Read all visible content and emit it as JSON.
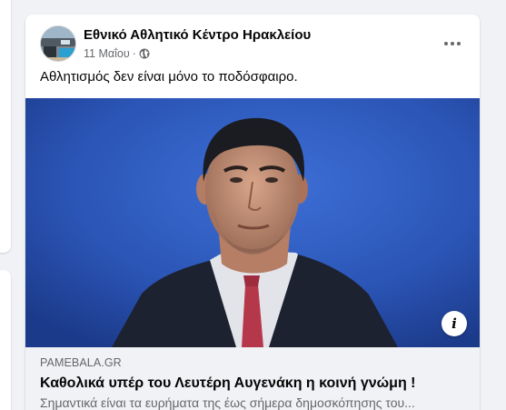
{
  "post": {
    "author": "Εθνικό Αθλητικό Κέντρο Ηρακλείου",
    "date": "11 Μαΐου",
    "separator": "·",
    "privacy_icon": "globe-icon",
    "more_icon": "more-horizontal-icon",
    "text": "Αθλητισμός δεν είναι μόνο το ποδόσφαιρο.",
    "image": {
      "description_icon": "info-icon",
      "info_label": "i"
    },
    "link_preview": {
      "domain": "PAMEBALA.GR",
      "title": "Καθολικά υπέρ του Λευτέρη Αυγενάκη η κοινή γνώμη !",
      "description": "Σημαντικά είναι τα ευρήματα της έως σήμερα δημοσκόπησης του..."
    }
  },
  "colors": {
    "page_bg": "#f0f2f5",
    "card_bg": "#ffffff",
    "primary_text": "#050505",
    "secondary_text": "#65676b",
    "photo_bg": "#2f56b7"
  }
}
